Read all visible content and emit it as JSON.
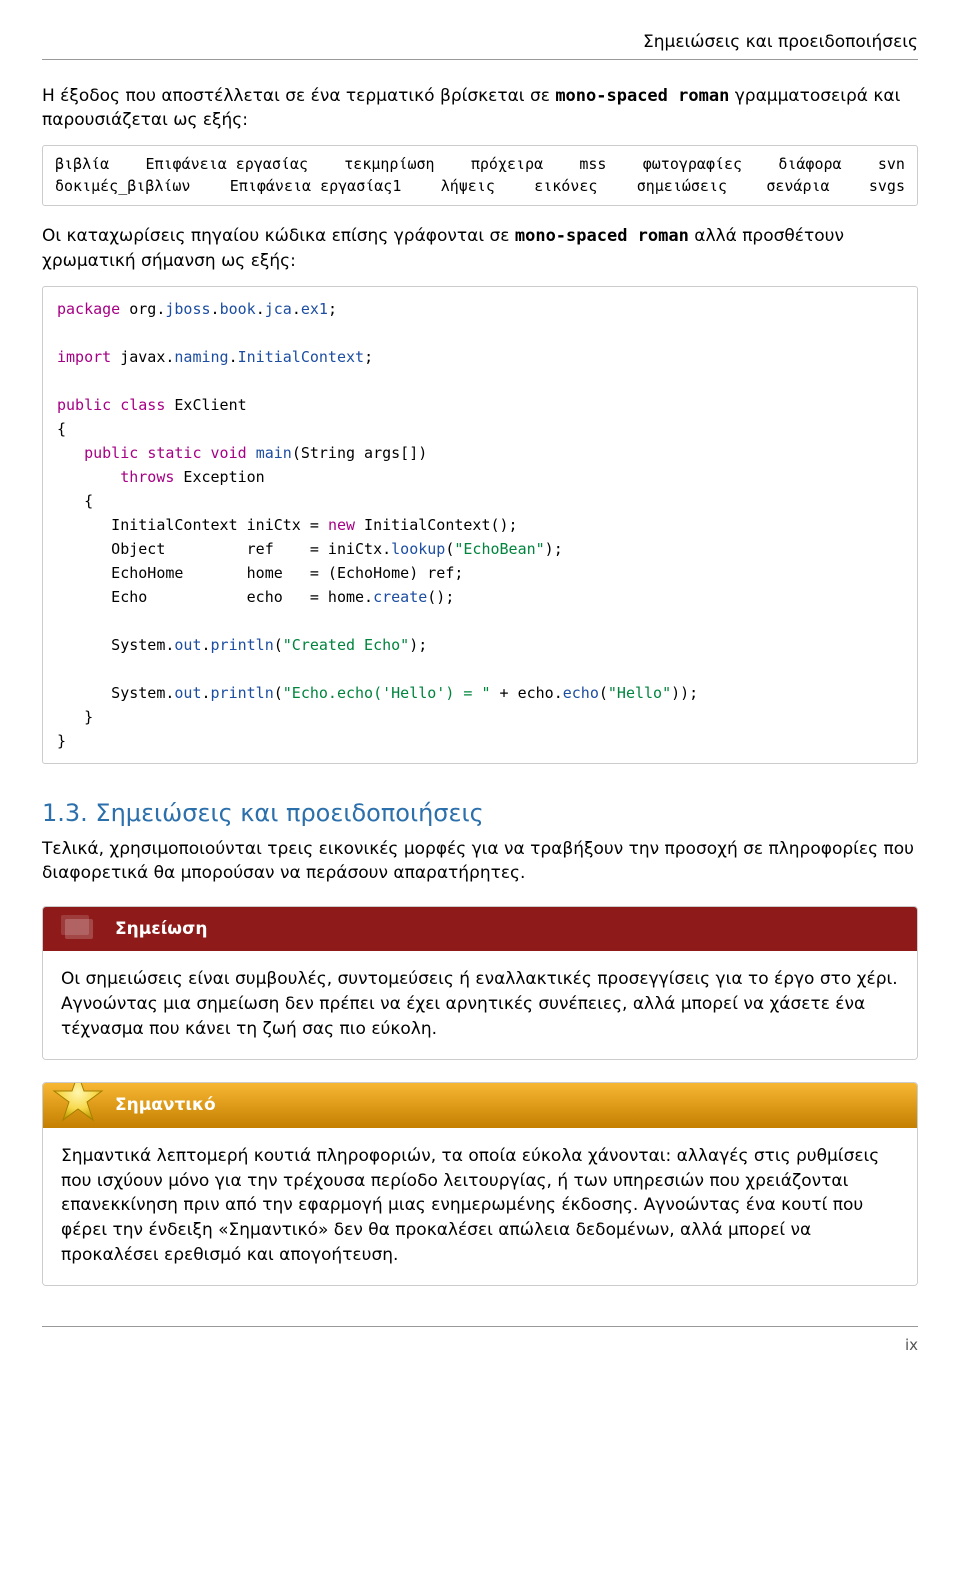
{
  "header": {
    "running_title": "Σημειώσεις και προειδοποιήσεις"
  },
  "intro": {
    "p1_before": "Η έξοδος που αποστέλλεται σε ένα τερματικό βρίσκεται σε ",
    "p1_mono": "mono-spaced roman",
    "p1_after": " γραμματοσειρά και παρουσιάζεται ως εξής:"
  },
  "output_example": {
    "w1": "βιβλία",
    "w2": "Επιφάνεια εργασίας",
    "w3": "τεκμηρίωση",
    "w4": "πρόχειρα",
    "w5": "mss",
    "w6": "φωτογραφίες",
    "w7": "διάφορα",
    "w8": "svn",
    "w9": "δοκιμές_βιβλίων",
    "w10": "Επιφάνεια εργασίας1",
    "w11": "λήψεις",
    "w12": "εικόνες",
    "w13": "σημειώσεις",
    "w14": "σενάρια",
    "w15": "svgs"
  },
  "intro2": {
    "p2_before": "Οι καταχωρίσεις πηγαίου κώδικα επίσης γράφονται σε ",
    "p2_mono": "mono-spaced roman",
    "p2_after": " αλλά προσθέτουν χρωματική σήμανση ως εξής:"
  },
  "code": {
    "l1_a": "package",
    "l1_b": " org.",
    "l1_c": "jboss",
    "l1_d": ".",
    "l1_e": "book",
    "l1_f": ".",
    "l1_g": "jca",
    "l1_h": ".",
    "l1_i": "ex1",
    "l1_j": ";",
    "l2_a": "import",
    "l2_b": " javax.",
    "l2_c": "naming",
    "l2_d": ".",
    "l2_e": "InitialContext",
    "l2_f": ";",
    "l3_a": "public",
    "l3_b": " ",
    "l3_c": "class",
    "l3_d": " ExClient",
    "l4_a": "{",
    "l5_a": "   ",
    "l5_b": "public",
    "l5_c": " ",
    "l5_d": "static",
    "l5_e": " ",
    "l5_f": "void",
    "l5_g": " ",
    "l5_h": "main",
    "l5_i": "(String args[])",
    "l6_a": "       ",
    "l6_b": "throws",
    "l6_c": " Exception",
    "l7_a": "   {",
    "l8_a": "      InitialContext iniCtx = ",
    "l8_b": "new",
    "l8_c": " InitialContext();",
    "l9_a": "      Object         ref    = iniCtx.",
    "l9_b": "lookup",
    "l9_c": "(",
    "l9_d": "\"EchoBean\"",
    "l9_e": ");",
    "l10_a": "      EchoHome       home   = (EchoHome) ref;",
    "l11_a": "      Echo           echo   = home.",
    "l11_b": "create",
    "l11_c": "();",
    "l12_a": "      System.",
    "l12_b": "out",
    "l12_c": ".",
    "l12_d": "println",
    "l12_e": "(",
    "l12_f": "\"Created Echo\"",
    "l12_g": ");",
    "l13_a": "      System.",
    "l13_b": "out",
    "l13_c": ".",
    "l13_d": "println",
    "l13_e": "(",
    "l13_f": "\"Echo.echo('Hello') = \"",
    "l13_g": " + echo.",
    "l13_h": "echo",
    "l13_i": "(",
    "l13_j": "\"Hello\"",
    "l13_k": "));",
    "l14_a": "   }",
    "l15_a": "}"
  },
  "section": {
    "heading": "1.3. Σημειώσεις και προειδοποιήσεις",
    "body": "Τελικά, χρησιμοποιούνται τρεις εικονικές μορφές για να τραβήξουν την προσοχή σε πληροφορίες που διαφορετικά θα μπορούσαν να περάσουν απαρατήρητες."
  },
  "admonitions": {
    "note_title": "Σημείωση",
    "note_body": "Οι σημειώσεις είναι συμβουλές, συντομεύσεις ή εναλλακτικές προσεγγίσεις για το έργο στο χέρι. Αγνοώντας μια σημείωση δεν πρέπει να έχει αρνητικές συνέπειες, αλλά μπορεί να χάσετε ένα τέχνασμα που κάνει τη ζωή σας πιο εύκολη.",
    "important_title": "Σημαντικό",
    "important_body": "Σημαντικά λεπτομερή κουτιά πληροφοριών, τα οποία εύκολα χάνονται: αλλαγές στις ρυθμίσεις που ισχύουν μόνο για την τρέχουσα περίοδο λειτουργίας, ή των υπηρεσιών που χρειάζονται επανεκκίνηση πριν από την εφαρμογή μιας ενημερωμένης έκδοσης. Αγνοώντας ένα κουτί που φέρει την ένδειξη «Σημαντικό» δεν θα προκαλέσει απώλεια δεδομένων, αλλά μπορεί να προκαλέσει ερεθισμό και απογοήτευση."
  },
  "footer": {
    "page_number": "ix"
  }
}
